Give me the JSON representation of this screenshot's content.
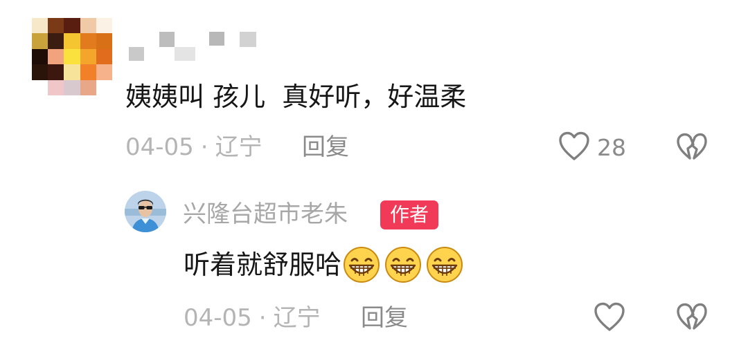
{
  "comment": {
    "text": "姨姨叫 孩儿  真好听，好温柔",
    "date": "04-05",
    "separator": "·",
    "location": "辽宁",
    "reply_label": "回复",
    "like_count": "28",
    "avatar_colors": [
      "#f6e8c8",
      "#7a3a18",
      "#5a1e10",
      "#f0c9a6",
      "#fbf1e4",
      "#c9a23c",
      "#3a1c10",
      "#f5c531",
      "#e27b1e",
      "#d77017",
      "#1e0d07",
      "#f0a37d",
      "#fbe13d",
      "#f4a52c",
      "#e26c1e",
      "#2a1409",
      "#3b170f",
      "#f7e39a",
      "#f28028",
      "#f6b28a",
      "#ffffff",
      "#f1c6c9",
      "#d8c9ce",
      "#e8a786",
      "#ffffff"
    ]
  },
  "reply": {
    "author_name": "兴隆台超市老朱",
    "author_badge": "作者",
    "text": "听着就舒服哈",
    "emoji_count": 3,
    "date": "04-05",
    "separator": "·",
    "location": "辽宁",
    "reply_label": "回复"
  },
  "icons": {
    "like": "heart-outline-icon",
    "dislike": "broken-heart-icon",
    "emoji": "grinning-face-emoji"
  }
}
